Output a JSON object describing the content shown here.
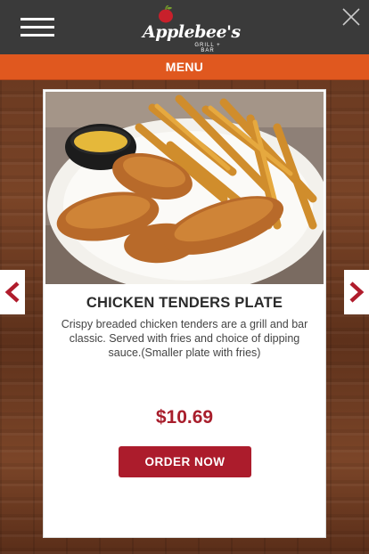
{
  "header": {
    "brand_name": "Applebee's",
    "brand_tagline": "GRILL + BAR"
  },
  "menubar": {
    "label": "MENU"
  },
  "item": {
    "title": "CHICKEN TENDERS PLATE",
    "description": "Crispy breaded chicken tenders are a grill and bar classic. Served with fries and choice of dipping sauce.(Smaller plate with fries)",
    "price": "$10.69",
    "order_label": "ORDER NOW"
  },
  "colors": {
    "header_bg": "#3a3a3a",
    "menubar_bg": "#e0581f",
    "accent_red": "#ac1c2c",
    "price_red": "#a81e2c"
  },
  "icons": {
    "menu": "hamburger-icon",
    "close": "close-icon",
    "prev": "chevron-left-icon",
    "next": "chevron-right-icon",
    "logo": "apple-icon"
  }
}
